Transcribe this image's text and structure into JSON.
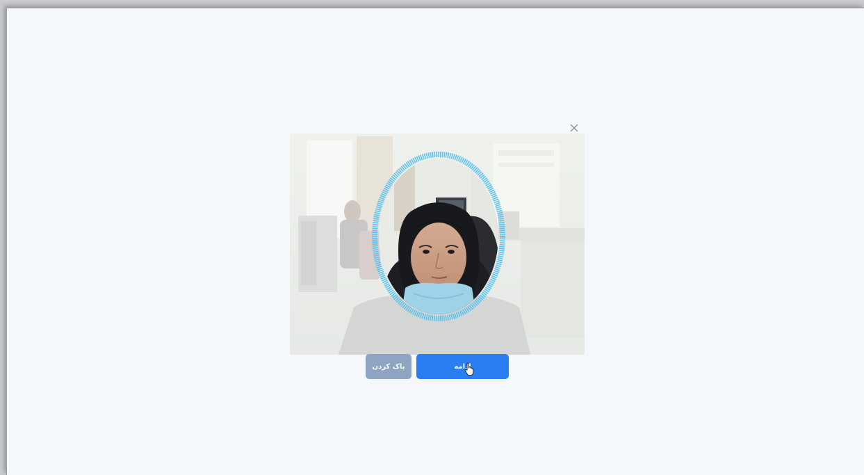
{
  "dialog": {
    "close_icon": "close-icon",
    "camera": {
      "face_guide_color": "#5cc3f0",
      "face_guide_shape": "oval"
    },
    "buttons": {
      "clear_label": "پاک کردن",
      "continue_label": "ادامه"
    }
  },
  "colors": {
    "primary": "#2b7ef2",
    "secondary": "#8fa3c2",
    "background": "#f4f8fb"
  },
  "icons": [
    "close-icon",
    "hand-pointer-icon"
  ]
}
